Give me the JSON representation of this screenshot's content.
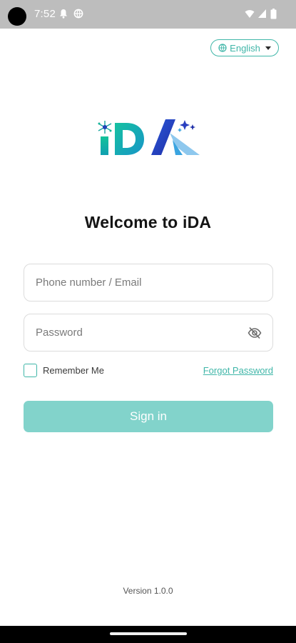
{
  "status_bar": {
    "time": "7:52",
    "icons": [
      "notification-bell-icon",
      "vpn-globe-icon",
      "wifi-icon",
      "cell-signal-icon",
      "battery-icon"
    ]
  },
  "language": {
    "label": "English",
    "icon": "globe-icon"
  },
  "logo": {
    "text": "iDA",
    "colors": {
      "i": "#17b59a",
      "D": "#1f3fb8",
      "A": "#3aa4e0",
      "accent": "#2a3fc0"
    }
  },
  "welcome": {
    "title": "Welcome to iDA"
  },
  "form": {
    "phone_placeholder": "Phone number / Email",
    "phone_value": "",
    "password_placeholder": "Password",
    "password_value": "",
    "remember_label": "Remember Me",
    "remember_checked": false,
    "forgot_label": "Forgot Password",
    "signin_label": "Sign in"
  },
  "footer": {
    "version": "Version 1.0.0"
  },
  "colors": {
    "accent": "#3fb6a8",
    "button_bg": "#82d3cb",
    "status_bar_bg": "#bdbdbd"
  }
}
